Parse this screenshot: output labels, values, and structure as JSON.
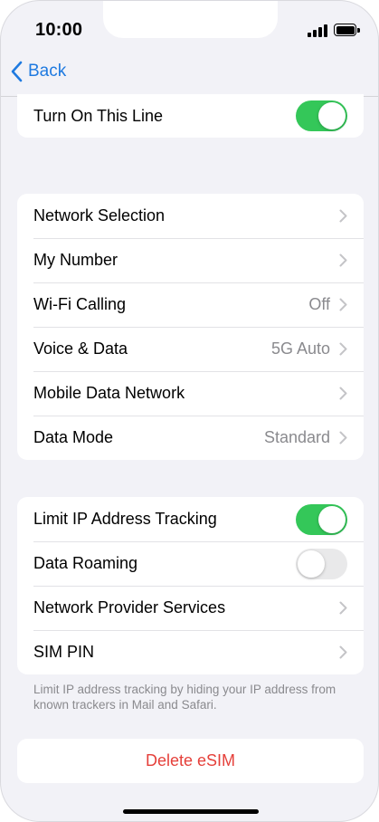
{
  "status_bar": {
    "time": "10:00"
  },
  "nav": {
    "back_label": "Back"
  },
  "group_top": {
    "rows": [
      {
        "label": "Turn On This Line",
        "toggle": true
      }
    ]
  },
  "group_network": {
    "rows": [
      {
        "label": "Network Selection",
        "value": ""
      },
      {
        "label": "My Number",
        "value": ""
      },
      {
        "label": "Wi-Fi Calling",
        "value": "Off"
      },
      {
        "label": "Voice & Data",
        "value": "5G Auto"
      },
      {
        "label": "Mobile Data Network",
        "value": ""
      },
      {
        "label": "Data Mode",
        "value": "Standard"
      }
    ]
  },
  "group_privacy": {
    "rows": [
      {
        "label": "Limit IP Address Tracking",
        "toggle": true
      },
      {
        "label": "Data Roaming",
        "toggle": false
      },
      {
        "label": "Network Provider Services"
      },
      {
        "label": "SIM PIN"
      }
    ]
  },
  "footnote": "Limit IP address tracking by hiding your IP address from known trackers in Mail and Safari.",
  "delete_label": "Delete eSIM",
  "colors": {
    "accent": "#1f7ae0",
    "toggle_on": "#34c759",
    "destructive": "#e5403a",
    "secondary_text": "#8a8a8e"
  },
  "icons": {
    "back": "chevron-left-icon",
    "row": "chevron-right-icon"
  }
}
